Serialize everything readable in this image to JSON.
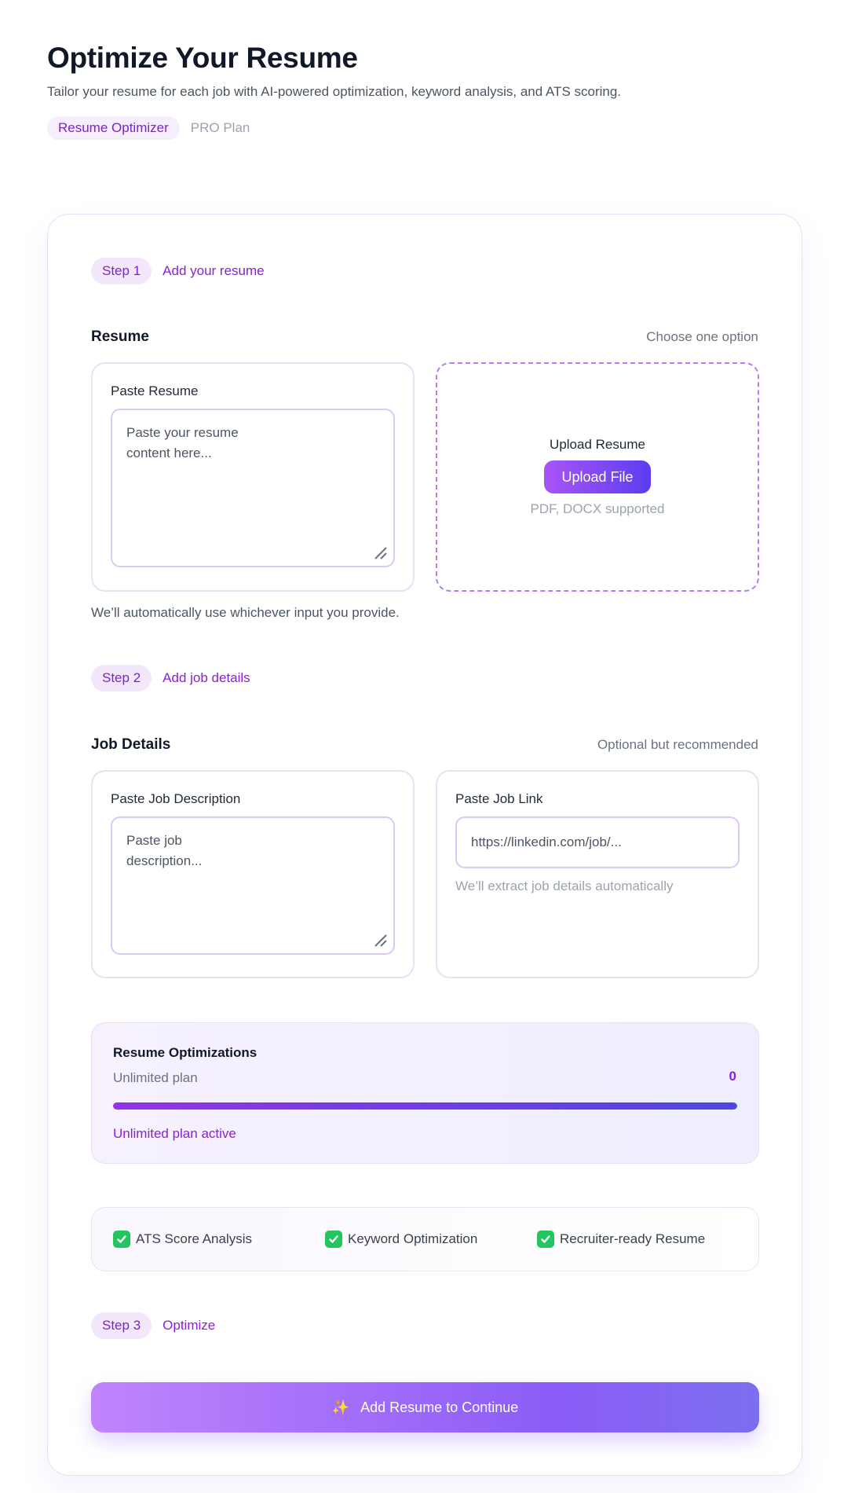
{
  "header": {
    "title": "Optimize Your Resume",
    "subtitle": "Tailor your resume for each job with AI-powered optimization, keyword analysis, and ATS scoring.",
    "tag_active": "Resume Optimizer",
    "tag_plan": "PRO Plan"
  },
  "step1": {
    "badge": "Step 1",
    "label": "Add your resume"
  },
  "resume": {
    "title": "Resume",
    "note": "Choose one option",
    "paste_label": "Paste Resume",
    "paste_placeholder": "Paste your resume content here...",
    "upload_title": "Upload Resume",
    "upload_button": "Upload File",
    "upload_hint": "PDF, DOCX supported",
    "auto_note": "We’ll automatically use whichever input you provide."
  },
  "step2": {
    "badge": "Step 2",
    "label": "Add job details"
  },
  "job": {
    "title": "Job Details",
    "note": "Optional but recommended",
    "desc_label": "Paste Job Description",
    "desc_placeholder": "Paste job description...",
    "link_label": "Paste Job Link",
    "link_placeholder": "https://linkedin.com/job/...",
    "link_hint": "We’ll extract job details automatically"
  },
  "usage": {
    "title": "Resume Optimizations",
    "subtitle": "Unlimited plan",
    "count": "0",
    "progress_fraction": 1.0,
    "status": "Unlimited plan active"
  },
  "features": [
    {
      "label": "ATS Score Analysis",
      "icon": "check-icon"
    },
    {
      "label": "Keyword Optimization",
      "icon": "check-icon"
    },
    {
      "label": "Recruiter-ready Resume",
      "icon": "check-icon"
    }
  ],
  "step3": {
    "badge": "Step 3",
    "label": "Optimize"
  },
  "cta": {
    "label": "Add Resume to Continue",
    "icon": "sparkle-icon"
  },
  "colors": {
    "accent": "#8b1fd6",
    "gradient_start": "#a855f7",
    "gradient_end": "#4f46e5"
  }
}
